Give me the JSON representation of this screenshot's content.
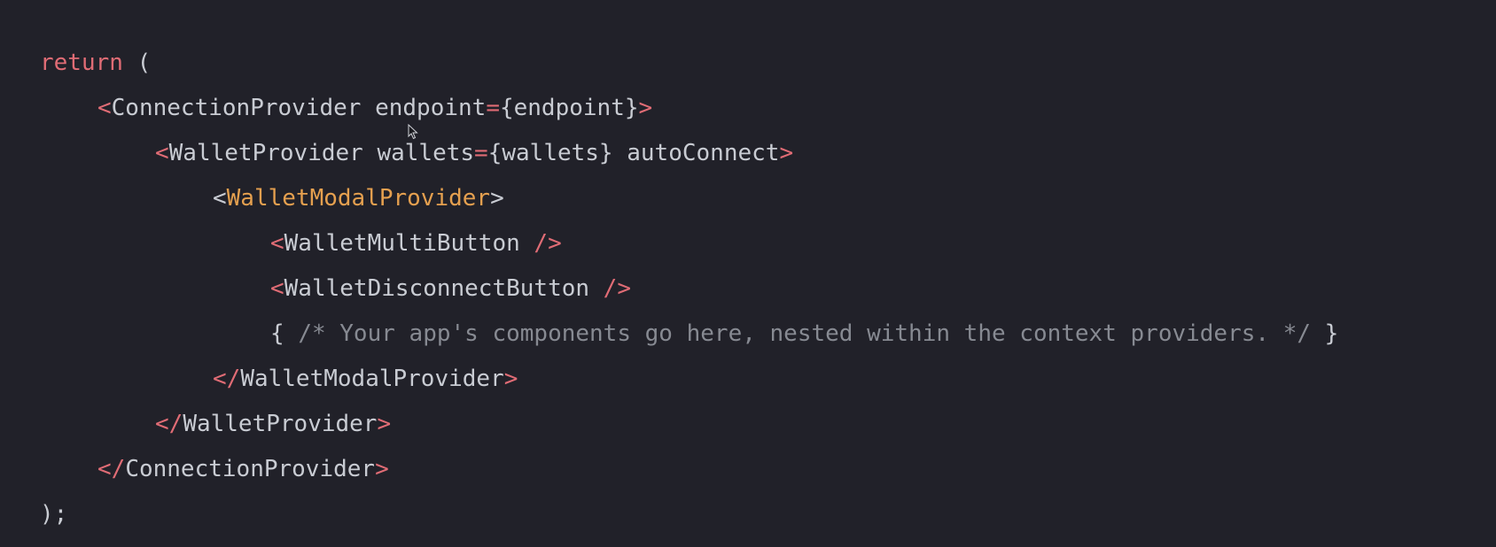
{
  "code": {
    "line1": {
      "keyword": "return",
      "open": " ("
    },
    "line2": {
      "lt": "<",
      "tag": "ConnectionProvider",
      "sp": " ",
      "attr": "endpoint",
      "eq": "=",
      "value": "{endpoint}",
      "gt": ">"
    },
    "line3": {
      "lt": "<",
      "tag": "WalletProvider",
      "sp": " ",
      "attr": "wallets",
      "eq": "=",
      "value": "{wallets}",
      "sp2": " ",
      "attr2": "autoConnect",
      "gt": ">"
    },
    "line4": {
      "lt": "<",
      "tag": "WalletModalProvider",
      "gt": ">"
    },
    "line5": {
      "lt": "<",
      "tag": "WalletMultiButton",
      "close": " />"
    },
    "line6": {
      "lt": "<",
      "tag": "WalletDisconnectButton",
      "close": " />"
    },
    "line7": {
      "open": "{ ",
      "comment": "/* Your app's components go here, nested within the context providers. */",
      "close": " }"
    },
    "line8": {
      "lt": "</",
      "tag": "WalletModalProvider",
      "gt": ">"
    },
    "line9": {
      "lt": "</",
      "tag": "WalletProvider",
      "gt": ">"
    },
    "line10": {
      "lt": "</",
      "tag": "ConnectionProvider",
      "gt": ">"
    },
    "line11": {
      "text": ");"
    }
  },
  "colors": {
    "background": "#212129",
    "default_text": "#c9ccd3",
    "keyword": "#e06c75",
    "highlighted_tag": "#e5a04f",
    "comment": "#878a92"
  },
  "icons": {
    "cursor": "mouse-pointer-icon"
  }
}
